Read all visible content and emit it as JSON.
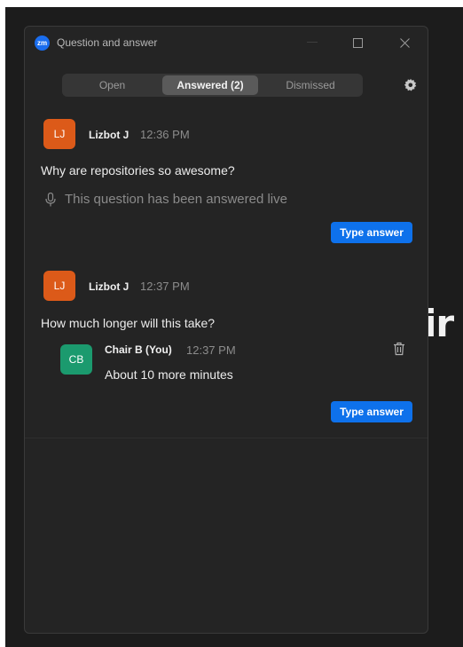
{
  "window": {
    "title": "Question and answer",
    "logo_text": "zm"
  },
  "tabs": [
    {
      "label": "Open",
      "active": false
    },
    {
      "label": "Answered (2)",
      "active": true
    },
    {
      "label": "Dismissed",
      "active": false
    }
  ],
  "questions": [
    {
      "avatar": "LJ",
      "author": "Lizbot J",
      "time": "12:36 PM",
      "text": "Why are repositories so awesome?",
      "status": "This question has been answered live",
      "button": "Type answer"
    },
    {
      "avatar": "LJ",
      "author": "Lizbot J",
      "time": "12:37 PM",
      "text": "How much longer will this take?",
      "reply": {
        "avatar": "CB",
        "author": "Chair B (You)",
        "time": "12:37 PM",
        "text": "About 10 more minutes"
      },
      "button": "Type answer"
    }
  ],
  "background_text": "ir",
  "colors": {
    "accent": "#0e71eb",
    "avatar_lj": "#dc5a19",
    "avatar_cb": "#1b9a6e",
    "window_bg": "#242424"
  }
}
